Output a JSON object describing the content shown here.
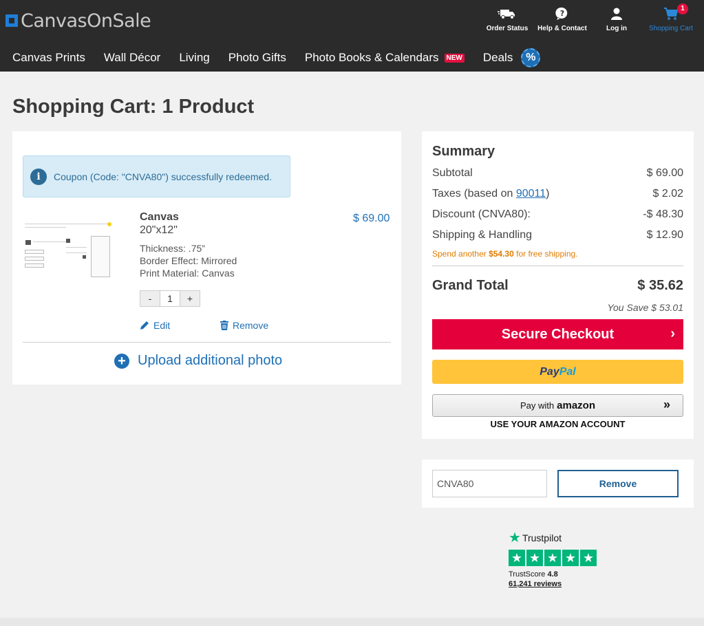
{
  "header": {
    "logo_text": "CanvasOnSale",
    "utility": [
      {
        "label": "Order Status",
        "icon": "truck-icon"
      },
      {
        "label": "Help & Contact",
        "icon": "help-icon"
      },
      {
        "label": "Log in",
        "icon": "user-icon"
      },
      {
        "label": "Shopping Cart",
        "icon": "cart-icon"
      }
    ],
    "cart_count": "1",
    "nav": [
      {
        "label": "Canvas Prints"
      },
      {
        "label": "Wall Décor"
      },
      {
        "label": "Living"
      },
      {
        "label": "Photo Gifts"
      },
      {
        "label": "Photo Books & Calendars",
        "badge": "NEW"
      },
      {
        "label": "Deals",
        "badge": "%"
      }
    ]
  },
  "page_title": "Shopping Cart: 1 Product",
  "cart": {
    "coupon_message": "Coupon (Code: \"CNVA80\") successfully redeemed.",
    "item": {
      "name": "Canvas",
      "size": "20\"x12\"",
      "price": "$ 69.00",
      "attributes": [
        "Thickness: .75”",
        "Border Effect: Mirrored",
        "Print Material: Canvas"
      ],
      "qty_minus": "-",
      "quantity": "1",
      "qty_plus": "+",
      "edit_label": "Edit",
      "remove_label": "Remove"
    },
    "upload_label": "Upload additional photo"
  },
  "summary": {
    "title": "Summary",
    "subtotal_label": "Subtotal",
    "subtotal_value": "$ 69.00",
    "taxes_label_pre": "Taxes (based on ",
    "taxes_zip": "90011",
    "taxes_label_post": ")",
    "taxes_value": "$ 2.02",
    "discount_label": "Discount (CNVA80):",
    "discount_value": "-$ 48.30",
    "shipping_label": "Shipping & Handling",
    "shipping_value": "$ 12.90",
    "free_ship_pre": "Spend another ",
    "free_ship_amount": "$54.30",
    "free_ship_post": " for free shipping.",
    "grand_label": "Grand Total",
    "grand_value": "$ 35.62",
    "you_save": "You Save $ 53.01",
    "checkout_label": "Secure Checkout",
    "paypal_pay": "Pay",
    "paypal_pal": "Pal",
    "amazon_pre": "Pay with",
    "amazon_brand": "amazon",
    "amazon_note": "USE YOUR AMAZON ACCOUNT"
  },
  "coupon": {
    "code_value": "CNVA80",
    "remove_label": "Remove"
  },
  "trustpilot": {
    "brand": "Trustpilot",
    "score_label": "TrustScore",
    "score": "4.8",
    "reviews": "61,241 reviews"
  },
  "colors": {
    "header_bg": "#2b2b2b",
    "accent_blue": "#1f6fb5",
    "checkout_red": "#e4003b",
    "paypal_yellow": "#ffc439",
    "trustpilot_green": "#00b67a",
    "free_ship_orange": "#e07b00"
  }
}
